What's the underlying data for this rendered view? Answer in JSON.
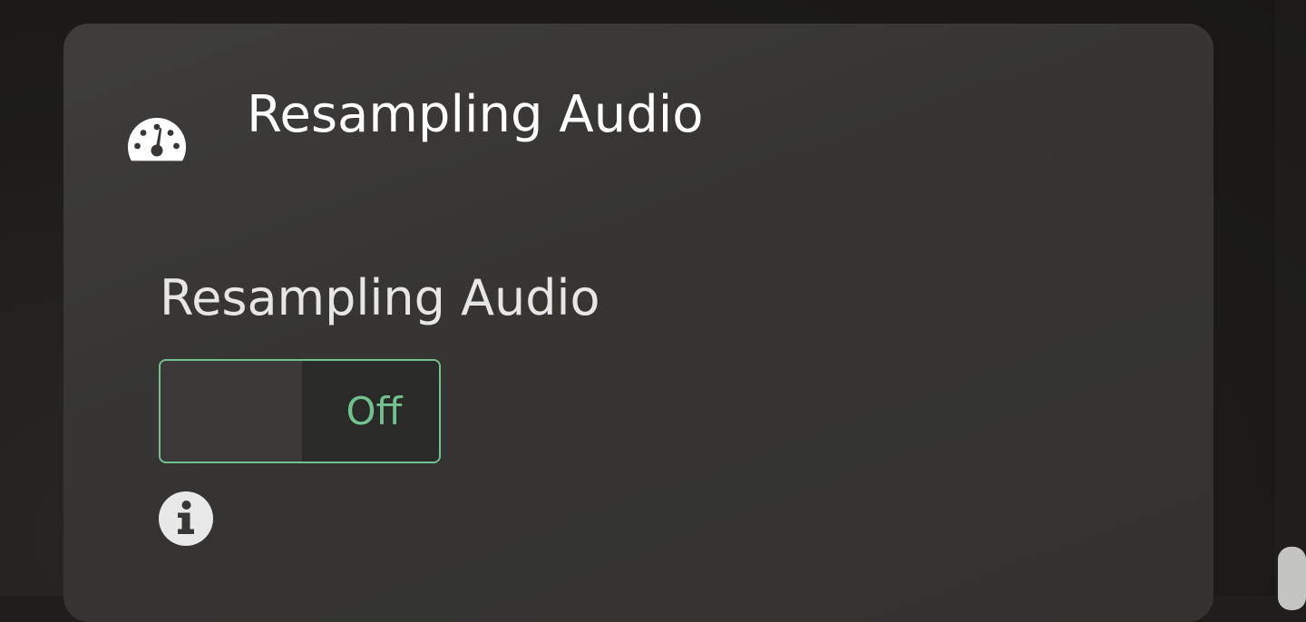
{
  "card": {
    "title": "Resampling Audio",
    "header_icon": "gauge-icon"
  },
  "setting": {
    "label": "Resampling Audio",
    "toggle": {
      "state_text": "Off",
      "value": false
    },
    "info_icon": "info-icon"
  },
  "colors": {
    "accent": "#72c28f",
    "card_background": "#383735",
    "page_background": "#1f1e1c",
    "title_text": "#ffffff"
  }
}
